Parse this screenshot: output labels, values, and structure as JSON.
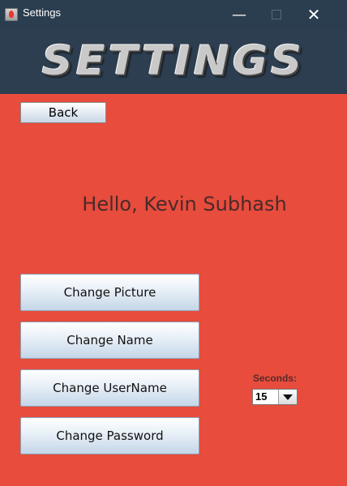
{
  "window": {
    "title": "Settings",
    "minimize_glyph": "—",
    "close_glyph": "✕"
  },
  "banner": {
    "text": "SETTINGS"
  },
  "back_button": {
    "label": "Back"
  },
  "greeting": "Hello, Kevin Subhash",
  "actions": [
    {
      "label": "Change Picture"
    },
    {
      "label": "Change Name"
    },
    {
      "label": "Change UserName"
    },
    {
      "label": "Change Password"
    }
  ],
  "seconds": {
    "label": "Seconds:",
    "selected": "15"
  },
  "colors": {
    "background": "#e74c3c",
    "header": "#2c3e50"
  },
  "icons": {
    "app": "java-icon",
    "dropdown": "triangle-down-icon"
  }
}
